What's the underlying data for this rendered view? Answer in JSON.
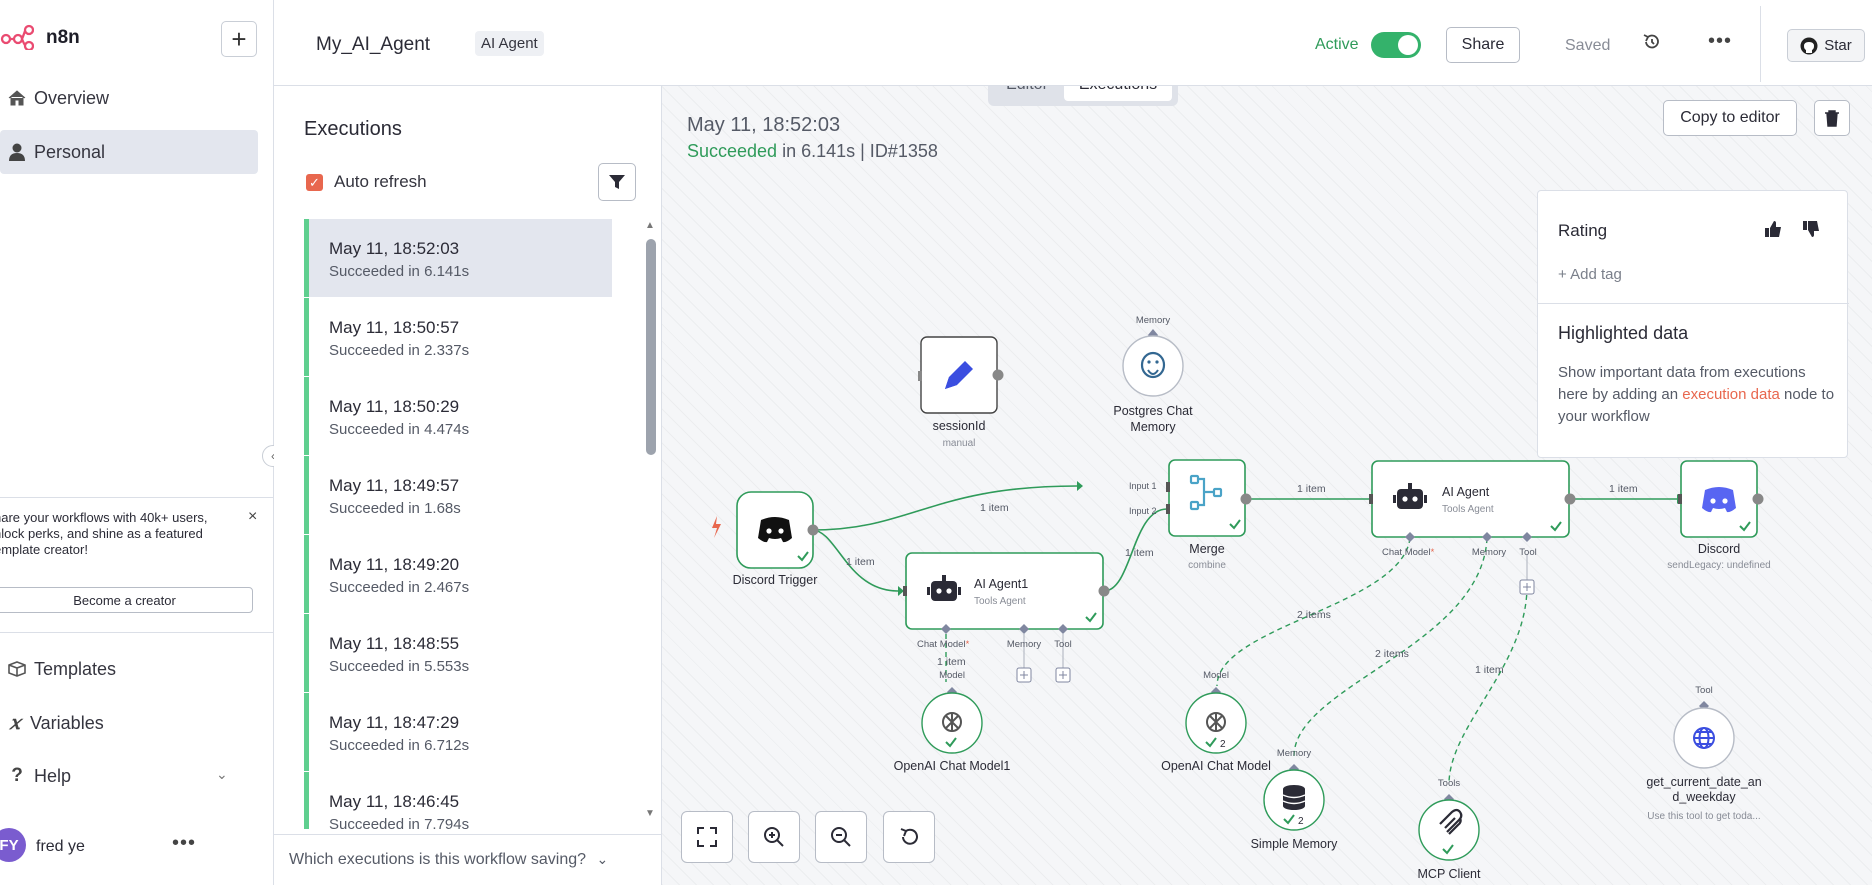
{
  "sidebar": {
    "logo": "n8n",
    "nav": [
      {
        "label": "Overview",
        "icon": "home-icon"
      },
      {
        "label": "Personal",
        "icon": "user-icon"
      }
    ],
    "promo": {
      "text": "hare your workflows with 40k+ users, nlock perks, and shine as a featured emplate creator!",
      "button": "Become a creator"
    },
    "bottom_nav": [
      {
        "label": "Templates",
        "icon": "box-icon"
      },
      {
        "label": "Variables",
        "icon": "variable-icon"
      },
      {
        "label": "Help",
        "icon": "question-icon"
      }
    ],
    "user": {
      "initials": "FY",
      "name": "fred ye"
    }
  },
  "topbar": {
    "workflow_name": "My_AI_Agent",
    "tag": "AI Agent",
    "active_label": "Active",
    "active": true,
    "share": "Share",
    "saved": "Saved",
    "star": "Star"
  },
  "mode": {
    "editor": "Editor",
    "executions": "Executions",
    "selected": "Executions"
  },
  "executions": {
    "title": "Executions",
    "auto_refresh": "Auto refresh",
    "items": [
      {
        "date": "May 11, 18:52:03",
        "status": "Succeeded in 6.141s"
      },
      {
        "date": "May 11, 18:50:57",
        "status": "Succeeded in 2.337s"
      },
      {
        "date": "May 11, 18:50:29",
        "status": "Succeeded in 4.474s"
      },
      {
        "date": "May 11, 18:49:57",
        "status": "Succeeded in 1.68s"
      },
      {
        "date": "May 11, 18:49:20",
        "status": "Succeeded in 2.467s"
      },
      {
        "date": "May 11, 18:48:55",
        "status": "Succeeded in 5.553s"
      },
      {
        "date": "May 11, 18:47:29",
        "status": "Succeeded in 6.712s"
      },
      {
        "date": "May 11, 18:46:45",
        "status": "Succeeded in 7.794s"
      }
    ],
    "saving_question": "Which executions is this workflow saving?"
  },
  "run": {
    "date": "May 11, 18:52:03",
    "status_word": "Succeeded",
    "status_rest": " in 6.141s | ID#1358",
    "copy": "Copy to editor"
  },
  "rating": {
    "label": "Rating",
    "add_tag": "+ Add tag",
    "hl_title": "Highlighted data",
    "hl_body_1": "Show important data from executions here by adding an ",
    "hl_link": "execution data",
    "hl_body_2": " node to your workflow"
  },
  "nodes": {
    "discord_trigger": "Discord Trigger",
    "session_id": "sessionId",
    "session_sub": "manual",
    "postgres": [
      "Postgres Chat",
      "Memory"
    ],
    "postgres_top": "Memory",
    "merge": "Merge",
    "merge_sub": "combine",
    "agent1": "AI Agent1",
    "agent1_sub": "Tools Agent",
    "agent": "AI Agent",
    "agent_sub": "Tools Agent",
    "discord": "Discord",
    "discord_sub": "sendLegacy: undefined",
    "openai1": "OpenAI Chat Model1",
    "openai": "OpenAI Chat Model",
    "simple_memory": "Simple Memory",
    "mcp": "MCP Client",
    "getdate": [
      "get_current_date_an",
      "d_weekday"
    ],
    "getdate_sub": "Use this tool to get toda...",
    "ports": {
      "chat_model": "Chat Model",
      "memory": "Memory",
      "tool": "Tool",
      "model": "Model",
      "tools": "Tools",
      "input1": "Input 1",
      "input2": "Input 2"
    },
    "edge_labels": {
      "one_item": "1 item",
      "two_items": "2 items",
      "one_item_model": "1 item"
    },
    "badge_two": "2"
  },
  "colors": {
    "accent": "#e8674e",
    "success": "#2f9b5a",
    "edge": "#2f9b5a",
    "port": "#8087a0"
  }
}
